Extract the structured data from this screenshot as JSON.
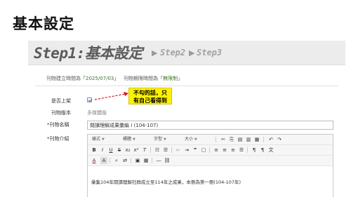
{
  "slide": {
    "title": "基本設定"
  },
  "steps": {
    "current": "Step1:基本設定",
    "arrow": "▶",
    "step2": "Step2",
    "step3": "Step3"
  },
  "info": {
    "created_label": "刊物建立時間為「",
    "created_value": "2025/07/03",
    "created_end": "」",
    "publish_label": "刊物期限時間為「",
    "publish_value": "無限制",
    "publish_end": "」"
  },
  "form": {
    "listing_label": "是否上架",
    "listing_checked": true,
    "version_label": "刊物版本",
    "version_value": "多媒體版",
    "name_label": "*刊物名稱",
    "name_value": "閱讀理解成果彙編 I (104-107)",
    "intro_label": "*刊物介紹"
  },
  "callout": {
    "line1": "不勾的話，只",
    "line2": "有自己看得到"
  },
  "editor": {
    "style_label": "樣式",
    "format_label": "標題",
    "font_label": "字型",
    "size_label": "大小",
    "toolbar_icons": [
      "cut-icon",
      "copy-icon",
      "paste-icon",
      "paste-text-icon",
      "paste-word-icon",
      "undo-icon",
      "redo-icon",
      "bold-icon",
      "italic-icon",
      "underline-icon",
      "strikethrough-icon",
      "subscript-icon",
      "superscript-icon",
      "remove-format-icon",
      "numbered-list-icon",
      "bullet-list-icon",
      "outdent-icon",
      "indent-icon",
      "blockquote-icon",
      "div-icon",
      "align-left-icon",
      "align-center-icon",
      "align-right-icon",
      "justify-icon",
      "ltr-icon",
      "rtl-icon",
      "language-icon",
      "text-color-icon",
      "background-color-icon",
      "find-icon",
      "replace-icon",
      "source-icon",
      "table-icon",
      "horizontal-line-icon",
      "link-icon"
    ],
    "content": "彙集104年閱讀理解社群成立至114年之成果，本冊為第一冊(104-107年)"
  }
}
